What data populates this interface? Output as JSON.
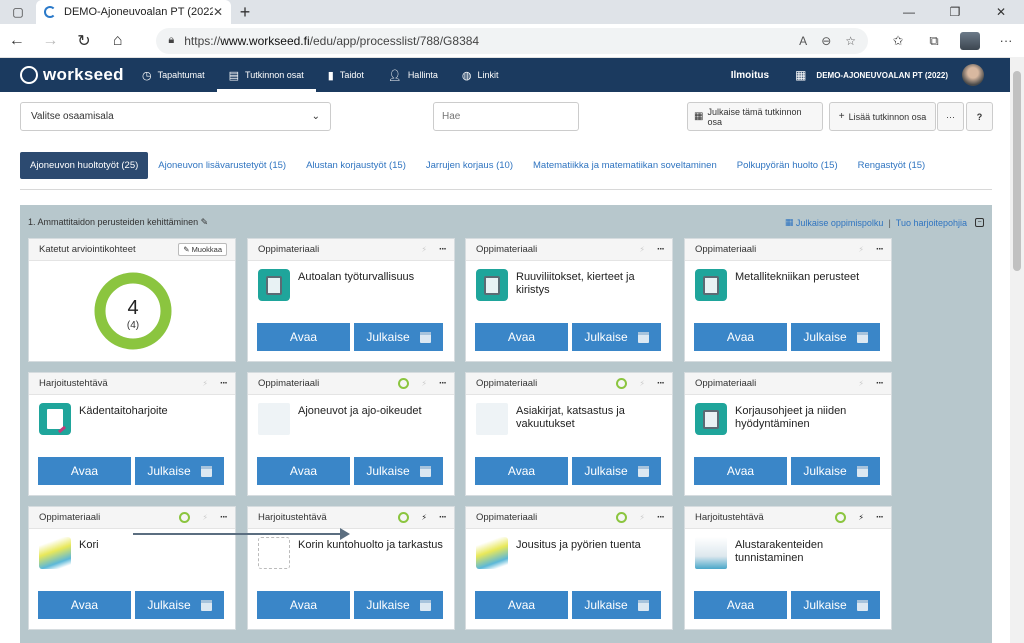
{
  "browser": {
    "tab_title": "DEMO-Ajoneuvoalan PT (2022)",
    "url_prefix": "https://",
    "url_host": "www.workseed.fi",
    "url_path": "/edu/app/processlist/788/G8384"
  },
  "appnav": {
    "logo": "workseed",
    "items": [
      {
        "label": "Tapahtumat",
        "icon": "clock-icon"
      },
      {
        "label": "Tutkinnon osat",
        "icon": "list-icon"
      },
      {
        "label": "Taidot",
        "icon": "bar-chart-icon"
      },
      {
        "label": "Hallinta",
        "icon": "user-plus-icon"
      },
      {
        "label": "Linkit",
        "icon": "globe-icon"
      }
    ],
    "notification": "Ilmoitus",
    "org": "DEMO-AJONEUVOALAN PT (2022)"
  },
  "toolbar": {
    "select_value": "Valitse osaamisala",
    "search_placeholder": "Hae",
    "publish_part": "Julkaise tämä tutkinnon osa",
    "add_part": "Lisää tutkinnon osa",
    "more": "···",
    "help": "?"
  },
  "tabs": [
    {
      "label": "Ajoneuvon huoltotyöt (25)",
      "active": true
    },
    {
      "label": "Ajoneuvon lisävarustetyöt (15)"
    },
    {
      "label": "Alustan korjaustyöt (15)"
    },
    {
      "label": "Jarrujen korjaus (10)"
    },
    {
      "label": "Matematiikka ja matematiikan soveltaminen"
    },
    {
      "label": "Polkupyörän huolto (15)"
    },
    {
      "label": "Rengastyöt (15)"
    }
  ],
  "section": {
    "title": "1. Ammattitaidon perusteiden kehittäminen",
    "publish_path": "Julkaise oppimispolku",
    "import_templates": "Tuo harjoitepohjia"
  },
  "donut": {
    "header": "Katetut arviointikohteet",
    "edit": "Muokkaa",
    "value": "4",
    "sub": "(4)",
    "color": "#8bc53f",
    "fraction": 1.0
  },
  "card_buttons": {
    "open": "Avaa",
    "publish": "Julkaise"
  },
  "cards": [
    {
      "type": "Oppimateriaali",
      "title": "Autoalan työturvallisuus",
      "thumb": "book"
    },
    {
      "type": "Oppimateriaali",
      "title": "Ruuviliitokset, kierteet ja kiristys",
      "thumb": "book"
    },
    {
      "type": "Oppimateriaali",
      "title": "Metallitekniikan perusteet",
      "thumb": "book"
    },
    {
      "type": "Harjoitustehtävä",
      "title": "Kädentaitoharjoite",
      "thumb": "task"
    },
    {
      "type": "Oppimateriaali",
      "title": "Ajoneuvot ja ajo-oikeudet",
      "thumb": "pic"
    },
    {
      "type": "Oppimateriaali",
      "title": "Asiakirjat, katsastus ja vakuutukset",
      "thumb": "pic"
    },
    {
      "type": "Oppimateriaali",
      "title": "Korjausohjeet ja niiden hyödyntäminen",
      "thumb": "book"
    },
    {
      "type": "Oppimateriaali",
      "title": "Kori",
      "thumb": "car"
    },
    {
      "type": "Harjoitustehtävä",
      "title": "Korin kuntohuolto ja tarkastus",
      "thumb": "wire"
    },
    {
      "type": "Oppimateriaali",
      "title": "Jousitus ja pyörien tuenta",
      "thumb": "car"
    },
    {
      "type": "Harjoitustehtävä",
      "title": "Alustarakenteiden tunnistaminen",
      "thumb": "lift"
    }
  ]
}
